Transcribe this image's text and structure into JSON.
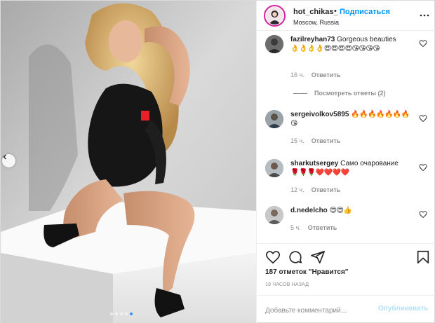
{
  "post": {
    "username": "hot_chikas_",
    "follow_separator": "•",
    "follow_label": "Подписаться",
    "location": "Moscow, Russia",
    "more_icon": "more-horizontal-icon",
    "carousel": {
      "slide_count": 5,
      "active_index": 4
    }
  },
  "comments": [
    {
      "username": "fazilreyhan73",
      "text": "Gorgeous beauties",
      "emojis": "👌👌👌👌😍😍😍😍😘😘😘😘",
      "time": "16 ч.",
      "reply": "Ответить"
    },
    {
      "username": "sergeivolkov5895",
      "text": "",
      "emojis": "🔥🔥🔥🔥🔥🔥🔥😘",
      "time": "15 ч.",
      "reply": "Ответить"
    },
    {
      "username": "sharkutsergey",
      "text": "Само очарование",
      "emojis": "🌹🌹🌹❤️❤️❤️❤️",
      "time": "12 ч.",
      "reply": "Ответить"
    },
    {
      "username": "d.nedelcho",
      "text": "",
      "emojis": "😍😍👍",
      "time": "5 ч.",
      "reply": "Ответить"
    }
  ],
  "view_replies_label": "Посмотреть ответы (2)",
  "actions": {
    "like_icon": "heart-outline-icon",
    "comment_icon": "comment-icon",
    "share_icon": "paper-plane-icon",
    "save_icon": "bookmark-icon"
  },
  "likes_text": "187 отметок \"Нравится\"",
  "time_ago": "18 часов назад",
  "add_comment": {
    "placeholder": "Добавьте комментарий...",
    "publish_label": "Опубликовать"
  },
  "colors": {
    "link_blue": "#0095f6",
    "publish_disabled": "#b2dffc",
    "meta_gray": "#8e8e8e",
    "carousel_active_dot": "#3897f0",
    "censor_red": "#e8202a"
  }
}
